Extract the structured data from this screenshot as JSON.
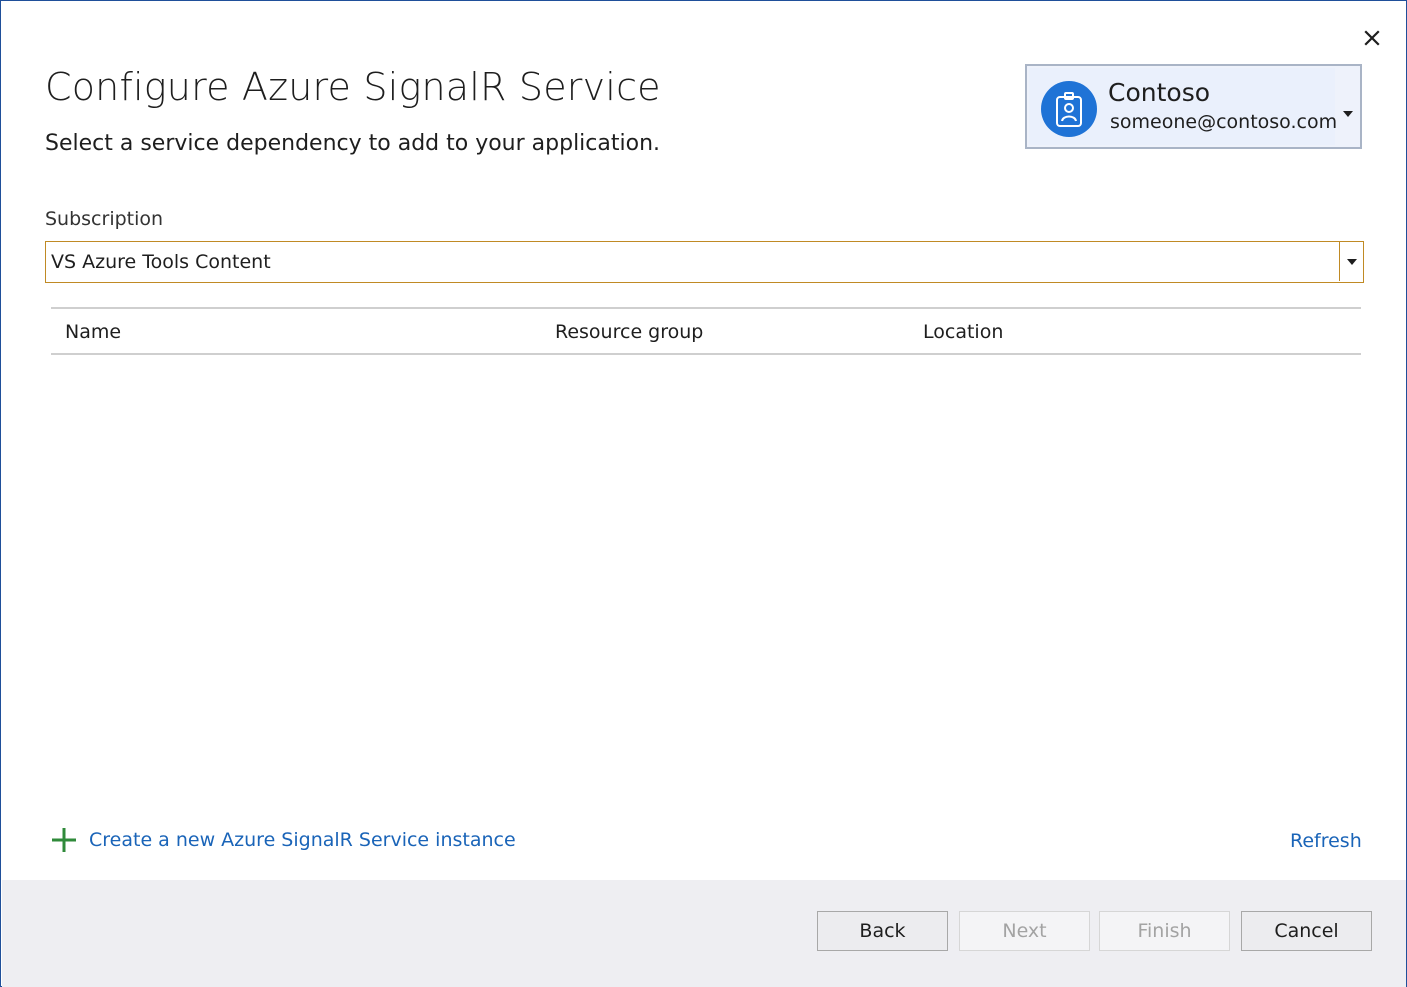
{
  "window": {
    "title": "Configure Azure SignalR Service",
    "subtitle": "Select a service dependency to add to your application."
  },
  "account": {
    "name": "Contoso",
    "email": "someone@contoso.com",
    "avatar_icon": "id-badge-icon",
    "avatar_color": "#1f73d6"
  },
  "subscription": {
    "label": "Subscription",
    "selected": "VS Azure Tools Content",
    "border_color": "#c08a24"
  },
  "table": {
    "columns": [
      "Name",
      "Resource group",
      "Location"
    ],
    "rows": []
  },
  "actions": {
    "create_label": "Create a new Azure SignalR Service instance",
    "create_icon": "plus-icon",
    "refresh_label": "Refresh",
    "link_color": "#1a64b8"
  },
  "footer": {
    "back_label": "Back",
    "next_label": "Next",
    "finish_label": "Finish",
    "cancel_label": "Cancel"
  }
}
